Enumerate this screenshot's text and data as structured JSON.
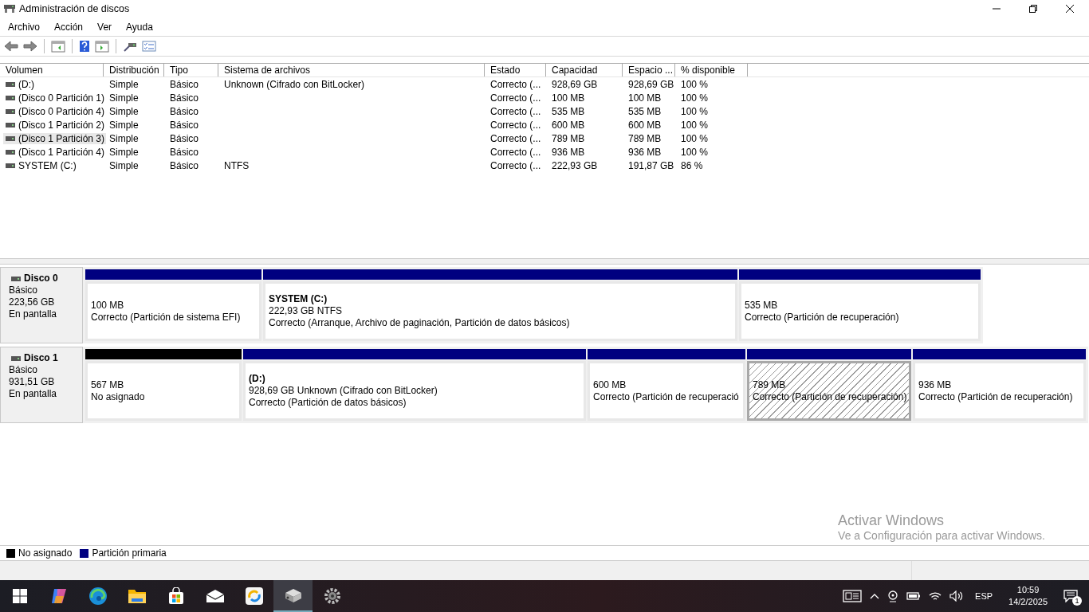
{
  "window": {
    "title": "Administración de discos"
  },
  "menu": [
    "Archivo",
    "Acción",
    "Ver",
    "Ayuda"
  ],
  "toolbar": [
    {
      "kind": "back"
    },
    {
      "kind": "forward"
    },
    {
      "kind": "sep"
    },
    {
      "kind": "tree"
    },
    {
      "kind": "sep"
    },
    {
      "kind": "help"
    },
    {
      "kind": "pane"
    },
    {
      "kind": "sep"
    },
    {
      "kind": "connect"
    },
    {
      "kind": "props"
    }
  ],
  "volumes": {
    "columns": [
      "Volumen",
      "Distribución",
      "Tipo",
      "Sistema de archivos",
      "Estado",
      "Capacidad",
      "Espacio ...",
      "% disponible"
    ],
    "rows": [
      {
        "selected": false,
        "cells": [
          " (D:)",
          "Simple",
          "Básico",
          "Unknown (Cifrado con BitLocker)",
          "Correcto (...",
          "928,69 GB",
          "928,69 GB",
          "100 %"
        ]
      },
      {
        "selected": false,
        "cells": [
          "(Disco 0 Partición 1)",
          "Simple",
          "Básico",
          "",
          "Correcto (...",
          "100 MB",
          "100 MB",
          "100 %"
        ]
      },
      {
        "selected": false,
        "cells": [
          "(Disco 0 Partición 4)",
          "Simple",
          "Básico",
          "",
          "Correcto (...",
          "535 MB",
          "535 MB",
          "100 %"
        ]
      },
      {
        "selected": false,
        "cells": [
          "(Disco 1 Partición 2)",
          "Simple",
          "Básico",
          "",
          "Correcto (...",
          "600 MB",
          "600 MB",
          "100 %"
        ]
      },
      {
        "selected": true,
        "cells": [
          "(Disco 1 Partición 3)",
          "Simple",
          "Básico",
          "",
          "Correcto (...",
          "789 MB",
          "789 MB",
          "100 %"
        ]
      },
      {
        "selected": false,
        "cells": [
          "(Disco 1 Partición 4)",
          "Simple",
          "Básico",
          "",
          "Correcto (...",
          "936 MB",
          "936 MB",
          "100 %"
        ]
      },
      {
        "selected": false,
        "cells": [
          "SYSTEM (C:)",
          "Simple",
          "Básico",
          "NTFS",
          "Correcto (...",
          "222,93 GB",
          "191,87 GB",
          "86 %"
        ]
      }
    ]
  },
  "disks": [
    {
      "name": "Disco 0",
      "type": "Básico",
      "size": "223,56 GB",
      "status": "En pantalla",
      "partitions": [
        {
          "kind": "primary",
          "selected": false,
          "size": "100 MB",
          "status": "Correcto (Partición de sistema EFI)"
        },
        {
          "kind": "primary",
          "selected": false,
          "name": "SYSTEM  (C:)",
          "size": "222,93 GB NTFS",
          "status": "Correcto (Arranque, Archivo de paginación, Partición de datos básicos)"
        },
        {
          "kind": "primary",
          "selected": false,
          "size": "535 MB",
          "status": "Correcto (Partición de recuperación)"
        }
      ]
    },
    {
      "name": "Disco 1",
      "type": "Básico",
      "size": "931,51 GB",
      "status": "En pantalla",
      "partitions": [
        {
          "kind": "unallocated",
          "selected": false,
          "size": "567 MB",
          "status": "No asignado"
        },
        {
          "kind": "primary",
          "selected": false,
          "name": "(D:)",
          "size": "928,69 GB Unknown (Cifrado con BitLocker)",
          "status": "Correcto (Partición de datos básicos)"
        },
        {
          "kind": "primary",
          "selected": false,
          "size": "600 MB",
          "status": "Correcto (Partición de recuperació"
        },
        {
          "kind": "primary",
          "selected": true,
          "size": "789 MB",
          "status": "Correcto (Partición de recuperación)"
        },
        {
          "kind": "primary",
          "selected": false,
          "size": "936 MB",
          "status": "Correcto (Partición de recuperación)"
        }
      ]
    }
  ],
  "legend": [
    {
      "kind": "unallocated",
      "label": "No asignado"
    },
    {
      "kind": "primary",
      "label": "Partición primaria"
    }
  ],
  "activation": {
    "title": "Activar Windows",
    "message": "Ve a Configuración para activar Windows."
  },
  "taskbar": {
    "apps": [
      {
        "kind": "start",
        "active": false
      },
      {
        "kind": "copilot",
        "active": false
      },
      {
        "kind": "edge",
        "active": false
      },
      {
        "kind": "explorer",
        "active": false
      },
      {
        "kind": "store",
        "active": false
      },
      {
        "kind": "mail",
        "active": false
      },
      {
        "kind": "sync",
        "active": false
      },
      {
        "kind": "diskmgmt",
        "active": true
      },
      {
        "kind": "gear",
        "active": false
      }
    ],
    "language": "ESP",
    "time": "10:59",
    "date": "14/2/2025",
    "notifications": "1"
  }
}
